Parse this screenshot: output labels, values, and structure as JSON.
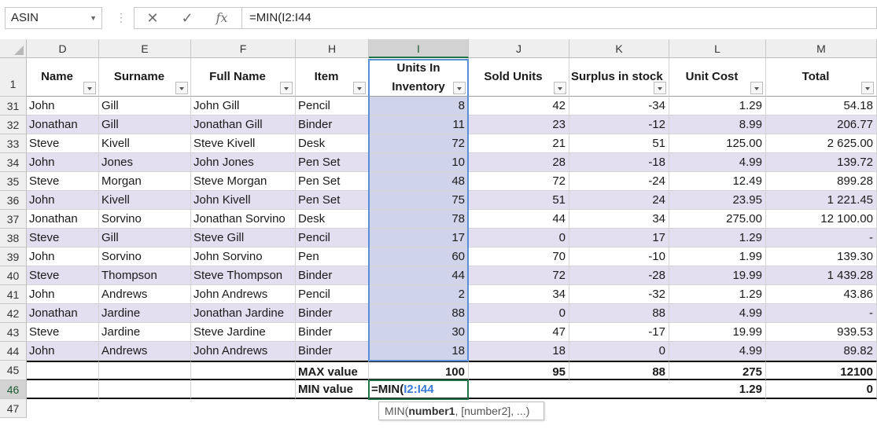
{
  "formula_bar": {
    "name_box": "ASIN",
    "cancel_icon": "✕",
    "enter_icon": "✓",
    "fx_icon": "fx",
    "formula": "=MIN(I2:I44"
  },
  "columns": [
    "D",
    "E",
    "F",
    "H",
    "I",
    "J",
    "K",
    "L",
    "M"
  ],
  "selected_column": "I",
  "header_row_number": "1",
  "headers": [
    "Name",
    "Surname",
    "Full Name",
    "Item",
    "Units In Inventory",
    "Sold Units",
    "Surplus in stock",
    "Unit Cost",
    "Total"
  ],
  "rows": [
    {
      "num": "31",
      "cells": [
        "John",
        "Gill",
        "John Gill",
        "Pencil",
        "8",
        "42",
        "-34",
        "1.29",
        "54.18"
      ]
    },
    {
      "num": "32",
      "cells": [
        "Jonathan",
        "Gill",
        "Jonathan Gill",
        "Binder",
        "11",
        "23",
        "-12",
        "8.99",
        "206.77"
      ]
    },
    {
      "num": "33",
      "cells": [
        "Steve",
        "Kivell",
        "Steve Kivell",
        "Desk",
        "72",
        "21",
        "51",
        "125.00",
        "2 625.00"
      ]
    },
    {
      "num": "34",
      "cells": [
        "John",
        "Jones",
        "John Jones",
        "Pen Set",
        "10",
        "28",
        "-18",
        "4.99",
        "139.72"
      ]
    },
    {
      "num": "35",
      "cells": [
        "Steve",
        "Morgan",
        "Steve Morgan",
        "Pen Set",
        "48",
        "72",
        "-24",
        "12.49",
        "899.28"
      ]
    },
    {
      "num": "36",
      "cells": [
        "John",
        "Kivell",
        "John Kivell",
        "Pen Set",
        "75",
        "51",
        "24",
        "23.95",
        "1 221.45"
      ]
    },
    {
      "num": "37",
      "cells": [
        "Jonathan",
        "Sorvino",
        "Jonathan Sorvino",
        "Desk",
        "78",
        "44",
        "34",
        "275.00",
        "12 100.00"
      ]
    },
    {
      "num": "38",
      "cells": [
        "Steve",
        "Gill",
        "Steve Gill",
        "Pencil",
        "17",
        "0",
        "17",
        "1.29",
        "-"
      ]
    },
    {
      "num": "39",
      "cells": [
        "John",
        "Sorvino",
        "John Sorvino",
        "Pen",
        "60",
        "70",
        "-10",
        "1.99",
        "139.30"
      ]
    },
    {
      "num": "40",
      "cells": [
        "Steve",
        "Thompson",
        "Steve Thompson",
        "Binder",
        "44",
        "72",
        "-28",
        "19.99",
        "1 439.28"
      ]
    },
    {
      "num": "41",
      "cells": [
        "John",
        "Andrews",
        "John Andrews",
        "Pencil",
        "2",
        "34",
        "-32",
        "1.29",
        "43.86"
      ]
    },
    {
      "num": "42",
      "cells": [
        "Jonathan",
        "Jardine",
        "Jonathan Jardine",
        "Binder",
        "88",
        "0",
        "88",
        "4.99",
        "-"
      ]
    },
    {
      "num": "43",
      "cells": [
        "Steve",
        "Jardine",
        "Steve Jardine",
        "Binder",
        "30",
        "47",
        "-17",
        "19.99",
        "939.53"
      ]
    },
    {
      "num": "44",
      "cells": [
        "John",
        "Andrews",
        "John Andrews",
        "Binder",
        "18",
        "18",
        "0",
        "4.99",
        "89.82"
      ]
    }
  ],
  "summary": {
    "max": {
      "num": "45",
      "label": "MAX value",
      "values": [
        "100",
        "95",
        "88",
        "275",
        "12100"
      ]
    },
    "min": {
      "num": "46",
      "label": "MIN value",
      "edit_prefix": "=MIN(",
      "edit_ref": "I2:I44",
      "l_value": "1.29",
      "m_value": "0"
    },
    "empty_row_num": "47"
  },
  "tooltip": {
    "fn": "MIN(",
    "arg1": "number1",
    "rest": ", [number2], ...)"
  },
  "colors": {
    "band": "#e4dff0",
    "selection": "#cfd4ea",
    "accent": "#217346",
    "ref_blue": "#3a7bd5"
  }
}
